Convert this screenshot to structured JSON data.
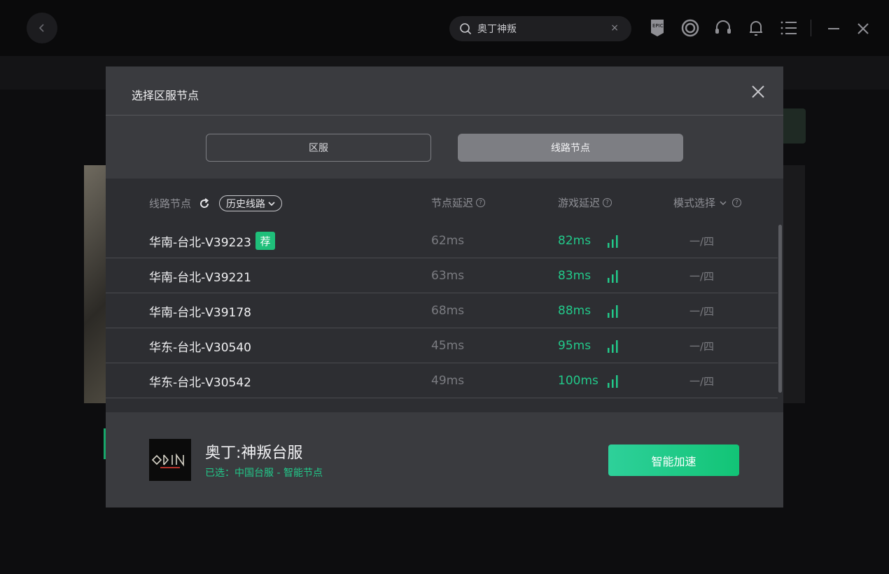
{
  "topbar": {
    "search": {
      "value": "奥丁神叛",
      "clear": "×"
    },
    "icons": [
      "epic-games-icon",
      "ubisoft-icon",
      "headset-icon",
      "bell-icon",
      "menu-icon"
    ],
    "window": {
      "minimize": "—",
      "close": "✕"
    }
  },
  "modal": {
    "title": "选择区服节点",
    "tabs": {
      "region": "区服",
      "nodes": "线路节点"
    },
    "table": {
      "headers": {
        "route": "线路节点",
        "history": "历史线路",
        "node_latency": "节点延迟",
        "game_latency": "游戏延迟",
        "mode": "模式选择"
      },
      "rows": [
        {
          "name": "华南-台北-V39223",
          "badge": "荐",
          "node_latency": "62ms",
          "game_latency": "82ms",
          "mode": "一/四"
        },
        {
          "name": "华南-台北-V39221",
          "node_latency": "63ms",
          "game_latency": "83ms",
          "mode": "一/四"
        },
        {
          "name": "华南-台北-V39178",
          "node_latency": "68ms",
          "game_latency": "88ms",
          "mode": "一/四"
        },
        {
          "name": "华东-台北-V30540",
          "node_latency": "45ms",
          "game_latency": "95ms",
          "mode": "一/四"
        },
        {
          "name": "华东-台北-V30542",
          "node_latency": "49ms",
          "game_latency": "100ms",
          "mode": "一/四"
        }
      ]
    },
    "footer": {
      "logo_text": "ODIN",
      "game_title": "奥丁:神叛台服",
      "selected": "已选：中国台服 - 智能节点",
      "accelerate": "智能加速"
    }
  },
  "colors": {
    "accent": "#22c98a",
    "modal_bg": "#3a3b3f",
    "table_bg": "#2d2e32"
  }
}
